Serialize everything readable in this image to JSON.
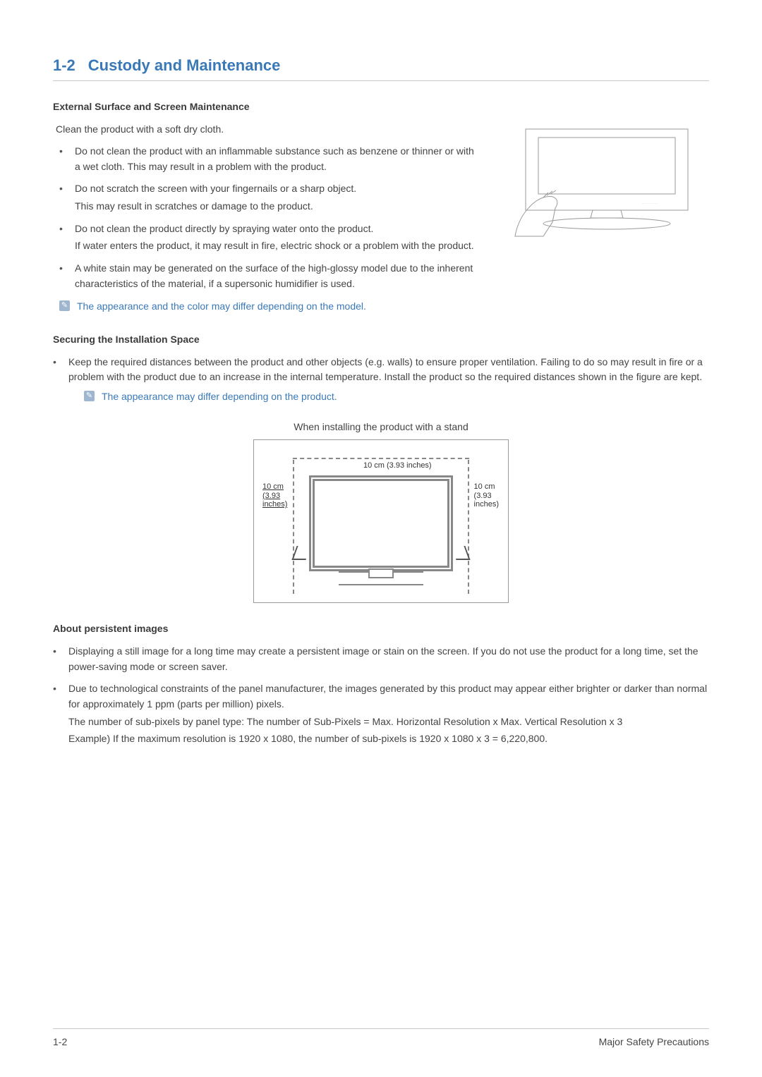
{
  "section": {
    "number": "1-2",
    "title": "Custody and Maintenance"
  },
  "h1": "External Surface and Screen Maintenance",
  "p_clean": "Clean the product with a soft dry cloth.",
  "list1": [
    "Do not clean the product with an inflammable substance such as benzene or thinner or with a wet cloth. This may result in a problem with the product.",
    "Do not scratch the screen with your fingernails or a sharp object.",
    "Do not clean the product directly by spraying water onto the product.",
    "A white stain may be generated on the surface of the high-glossy model due to the inherent characteristics of the material, if a supersonic humidifier is used."
  ],
  "list1_sub": {
    "1": "This may result in scratches or damage to the product.",
    "2": "If water enters the product, it may result in fire, electric shock or a problem with the product."
  },
  "note1": "The appearance and the color may differ depending on the model.",
  "h2": "Securing the Installation Space",
  "list2": [
    "Keep the required distances between the product and other objects (e.g. walls) to ensure proper ventilation. Failing to do so may result in fire or a problem with the product due to an increase in the internal temperature. Install the product so the required distances shown in the figure are kept."
  ],
  "note2": "The appearance may differ depending on the product.",
  "diagram_caption": "When installing the product with a stand",
  "diagram_labels": {
    "top": "10 cm (3.93 inches)",
    "left": "10 cm\n(3.93\ninches)",
    "right": "10 cm\n(3.93\ninches)"
  },
  "h3": "About persistent images",
  "list3": [
    "Displaying a still image for a long time may create a persistent image or stain on the screen. If you do not use the product for a long time, set the power-saving mode or screen saver.",
    "Due to technological constraints of the panel manufacturer, the images generated by this product may appear either brighter or darker than normal for approximately 1 ppm (parts per million) pixels."
  ],
  "list3_sub": {
    "formula": "The number of sub-pixels by panel type:  The number of Sub-Pixels = Max. Horizontal Resolution x Max. Vertical Resolution x 3",
    "example": "Example) If the maximum resolution is 1920 x 1080, the number of sub-pixels is 1920 x 1080 x 3 = 6,220,800."
  },
  "footer": {
    "left": "1-2",
    "right": "Major Safety Precautions"
  }
}
